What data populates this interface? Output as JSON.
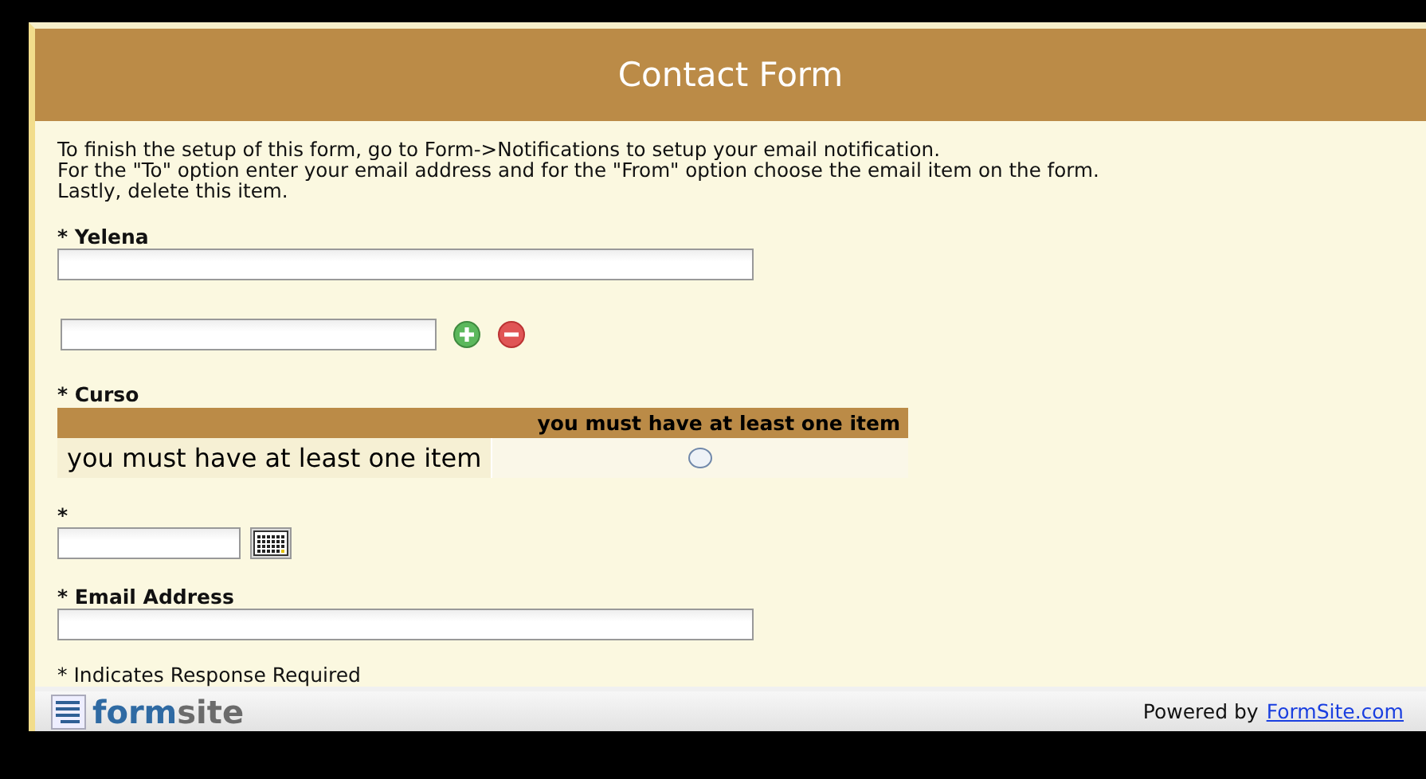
{
  "header": {
    "title": "Contact Form"
  },
  "instructions": [
    "To finish the setup of this form, go to Form->Notifications to setup your email notification.",
    "For the \"To\" option enter your email address and for the \"From\" option choose the email item on the form.",
    "Lastly, delete this item."
  ],
  "fields": [
    {
      "kind": "text",
      "label": "* Yelena"
    },
    {
      "kind": "repeat"
    },
    {
      "kind": "matrix",
      "label": "* Curso",
      "columns": [
        "you must have at least one item"
      ],
      "rows": [
        {
          "label": "you must have at least one item",
          "options": [
            {
              "selected": false
            }
          ]
        }
      ]
    },
    {
      "kind": "date",
      "label": "*"
    },
    {
      "kind": "text",
      "label": "* Email Address"
    }
  ],
  "note": "* Indicates Response Required",
  "footer": {
    "logo": [
      {
        "text": "form",
        "color": "#2f6aa3"
      },
      {
        "text": "site",
        "color": "#6b6b6b"
      }
    ],
    "powered_by": "Powered by",
    "link": "FormSite.com"
  }
}
